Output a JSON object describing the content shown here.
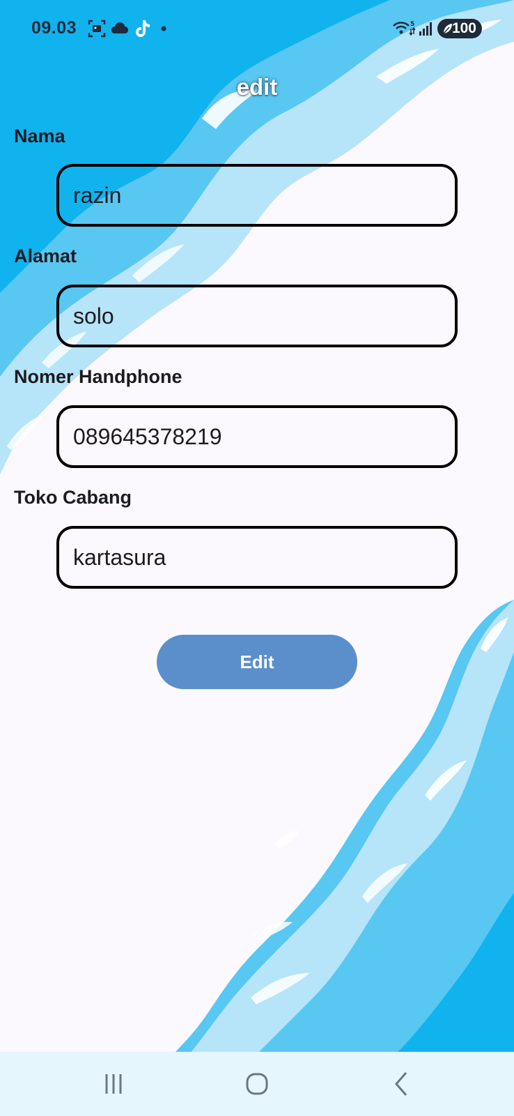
{
  "status_bar": {
    "time": "09.03",
    "battery": "100",
    "icons": [
      "screenshot-icon",
      "cloud-icon",
      "tiktok-icon",
      "dot-icon",
      "wifi-icon",
      "signal-icon",
      "battery-icon"
    ]
  },
  "page": {
    "title": "edit"
  },
  "form": {
    "nama": {
      "label": "Nama",
      "value": "razin"
    },
    "alamat": {
      "label": "Alamat",
      "value": "solo"
    },
    "phone": {
      "label": "Nomer Handphone",
      "value": "089645378219"
    },
    "toko": {
      "label": "Toko Cabang",
      "value": "kartasura"
    },
    "submit_label": "Edit"
  },
  "nav_bar": {
    "buttons": [
      "recent-apps-icon",
      "home-icon",
      "back-icon"
    ]
  },
  "colors": {
    "background": "#fbf9fd",
    "wave_dark": "#10b3ee",
    "wave_mid": "#58c7f2",
    "wave_light": "#b6e4f9",
    "button": "#5b8fcb",
    "nav_bar": "#e6f6fd"
  }
}
